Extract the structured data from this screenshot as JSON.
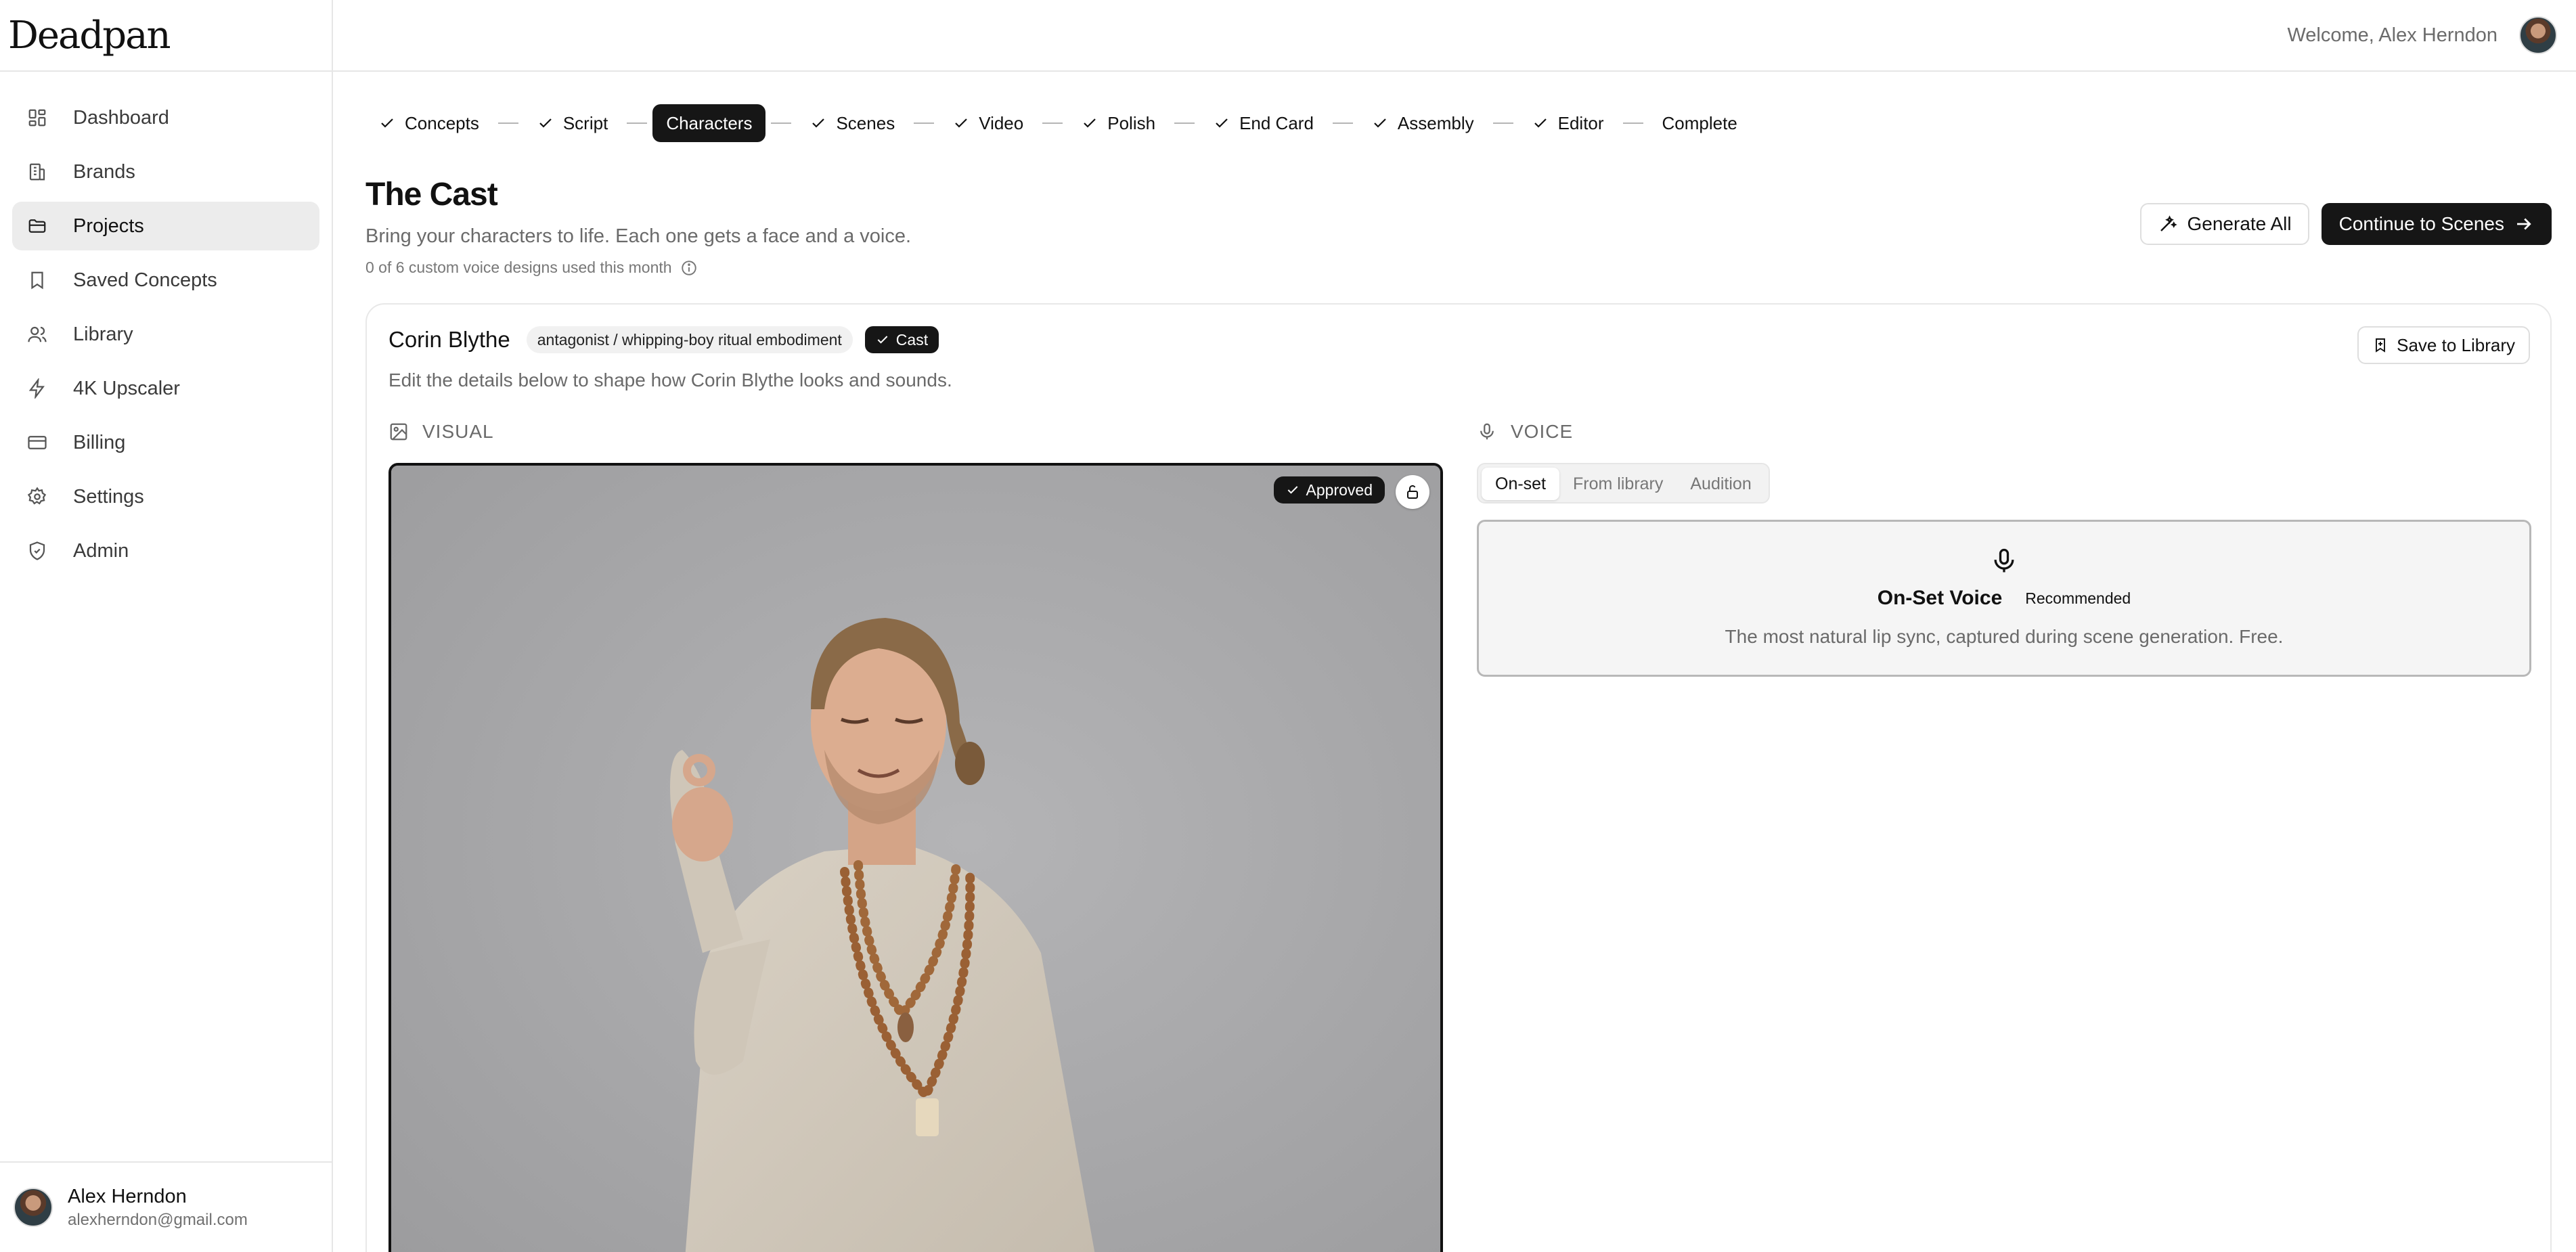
{
  "app": {
    "logo": "Deadpan"
  },
  "sidebar": {
    "items": [
      {
        "label": "Dashboard",
        "icon": "dashboard-icon"
      },
      {
        "label": "Brands",
        "icon": "building-icon"
      },
      {
        "label": "Projects",
        "icon": "folder-icon",
        "active": true
      },
      {
        "label": "Saved Concepts",
        "icon": "bookmark-icon"
      },
      {
        "label": "Library",
        "icon": "users-icon"
      },
      {
        "label": "4K Upscaler",
        "icon": "bolt-icon"
      },
      {
        "label": "Billing",
        "icon": "credit-card-icon"
      },
      {
        "label": "Settings",
        "icon": "gear-icon"
      },
      {
        "label": "Admin",
        "icon": "shield-icon"
      }
    ]
  },
  "user": {
    "name": "Alex Herndon",
    "email": "alexherndon@gmail.com"
  },
  "header": {
    "welcome": "Welcome, Alex Herndon"
  },
  "stepper": {
    "steps": [
      {
        "label": "Concepts",
        "done": true
      },
      {
        "label": "Script",
        "done": true
      },
      {
        "label": "Characters",
        "active": true
      },
      {
        "label": "Scenes",
        "done": true
      },
      {
        "label": "Video",
        "done": true
      },
      {
        "label": "Polish",
        "done": true
      },
      {
        "label": "End Card",
        "done": true
      },
      {
        "label": "Assembly",
        "done": true
      },
      {
        "label": "Editor",
        "done": true
      },
      {
        "label": "Complete",
        "done": false
      }
    ]
  },
  "page": {
    "title": "The Cast",
    "subtitle": "Bring your characters to life. Each one gets a face and a voice.",
    "quota": "0 of 6 custom voice designs used this month"
  },
  "actions": {
    "generate_all": "Generate All",
    "continue": "Continue to Scenes"
  },
  "character": {
    "name": "Corin Blythe",
    "role": "antagonist / whipping-boy ritual embodiment",
    "cast_badge": "Cast",
    "description": "Edit the details below to shape how Corin Blythe looks and sounds.",
    "save_to_library": "Save to Library",
    "visual": {
      "label": "VISUAL",
      "status": "Approved"
    },
    "voice": {
      "label": "VOICE",
      "tabs": [
        "On-set",
        "From library",
        "Audition"
      ],
      "active_tab": "On-set",
      "onset": {
        "title": "On-Set Voice",
        "badge": "Recommended",
        "description": "The most natural lip sync, captured during scene generation. Free."
      }
    }
  },
  "colors": {
    "accent_dark": "#161616",
    "active_nav_bg": "#ececec",
    "border": "#e6e6e6"
  }
}
